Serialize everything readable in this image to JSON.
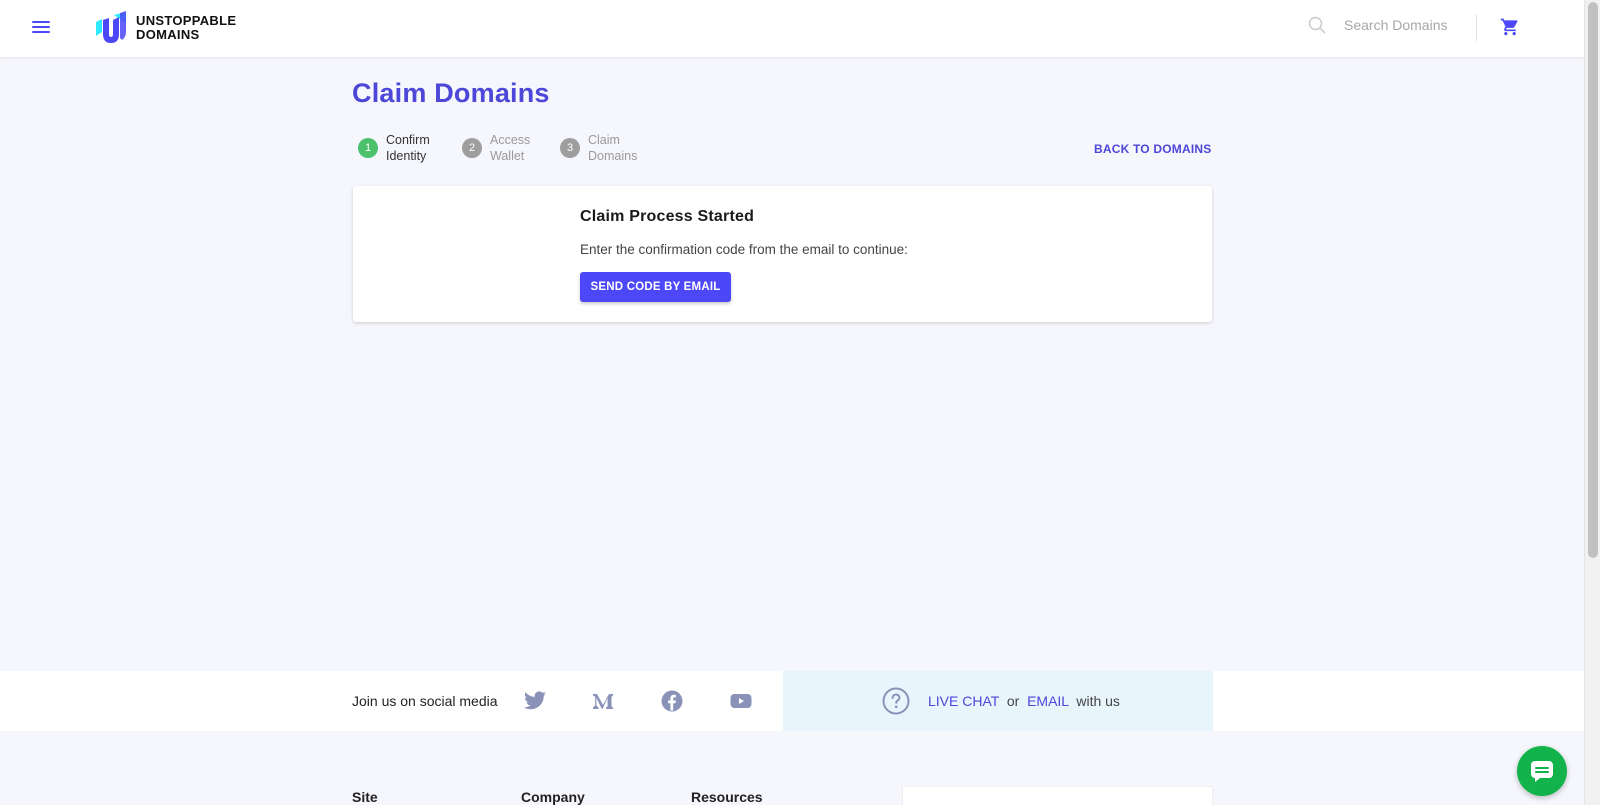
{
  "header": {
    "logo_line1": "UNSTOPPABLE",
    "logo_line2": "DOMAINS",
    "search_placeholder": "Search Domains",
    "icons": [
      "menu-icon",
      "logo-icon",
      "search-icon",
      "cart-icon"
    ]
  },
  "page": {
    "title": "Claim Domains",
    "back_link": "BACK TO DOMAINS"
  },
  "stepper": {
    "steps": [
      {
        "number": "1",
        "line1": "Confirm",
        "line2": "Identity",
        "state": "active"
      },
      {
        "number": "2",
        "line1": "Access",
        "line2": "Wallet",
        "state": "inactive"
      },
      {
        "number": "3",
        "line1": "Claim",
        "line2": "Domains",
        "state": "inactive"
      }
    ]
  },
  "card": {
    "title": "Claim Process Started",
    "text": "Enter the confirmation code from the email to continue:",
    "button": "SEND CODE BY EMAIL"
  },
  "social": {
    "label": "Join us on social media",
    "icons": [
      "twitter-icon",
      "medium-icon",
      "facebook-icon",
      "youtube-icon"
    ]
  },
  "help": {
    "live_chat": "LIVE CHAT",
    "or": "or",
    "email": "EMAIL",
    "suffix": "with us"
  },
  "footer": {
    "columns": [
      "Site",
      "Company",
      "Resources"
    ]
  },
  "colors": {
    "brand": "#4c47f7",
    "title": "#4c47d8",
    "step_active": "#4bc16b",
    "step_inactive": "#9e9e9e",
    "chat": "#13b34b"
  }
}
